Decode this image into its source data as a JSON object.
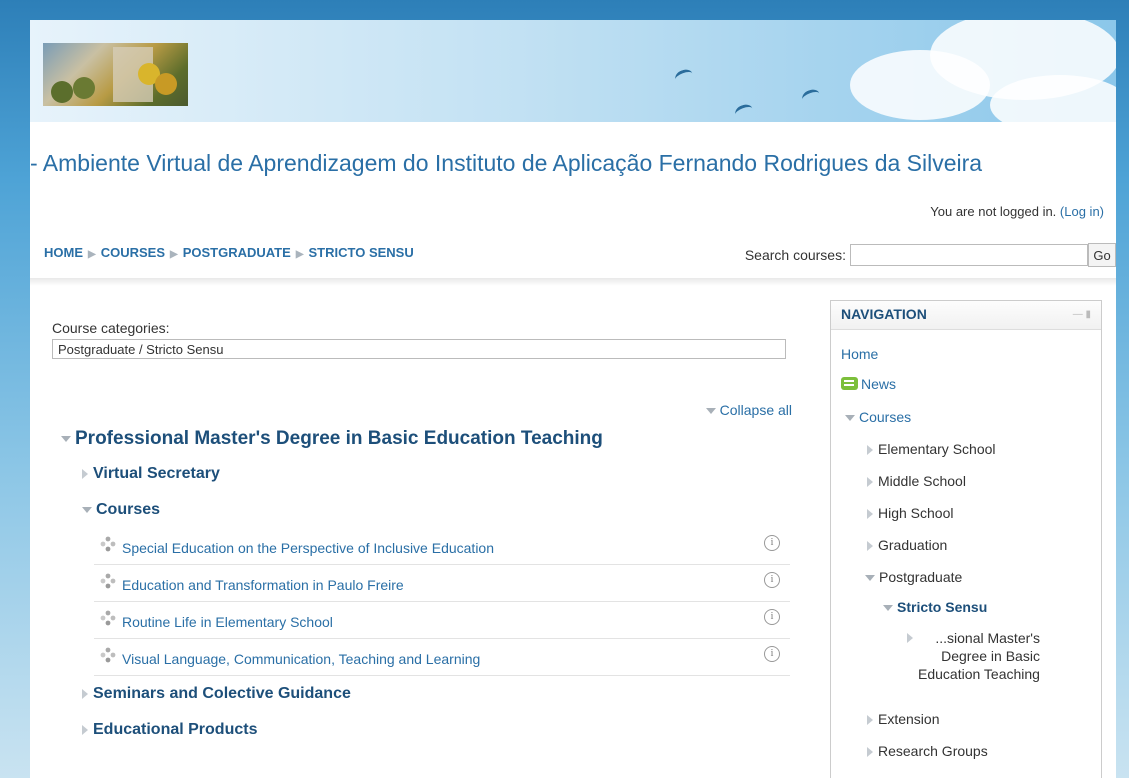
{
  "header": {
    "site_title": "- Ambiente Virtual de Aprendizagem do Instituto de Aplicação Fernando Rodrigues da Silveira",
    "login_text": "You are not logged in.",
    "login_link": "(Log in)"
  },
  "breadcrumb": [
    "HOME",
    "COURSES",
    "POSTGRADUATE",
    "STRICTO SENSU"
  ],
  "search": {
    "label": "Search courses:",
    "value": "",
    "go_label": "Go"
  },
  "main": {
    "categories_label": "Course categories:",
    "categories_selected": "Postgraduate / Stricto Sensu",
    "collapse_all": "Collapse all",
    "category_title": "Professional Master's Degree in Basic Education Teaching",
    "subcategories": [
      {
        "label": "Virtual Secretary",
        "expanded": false
      },
      {
        "label": "Courses",
        "expanded": true
      },
      {
        "label": "Seminars and Colective Guidance",
        "expanded": false
      },
      {
        "label": "Educational Products",
        "expanded": false
      }
    ],
    "courses": [
      "Special Education on the Perspective of Inclusive Education",
      "Education and Transformation in Paulo Freire",
      "Routine Life in Elementary School",
      "Visual Language, Communication, Teaching and Learning"
    ]
  },
  "navigation": {
    "title": "NAVIGATION",
    "home": "Home",
    "news": "News",
    "courses": "Courses",
    "items": [
      "Elementary School",
      "Middle School",
      "High School",
      "Graduation",
      "Postgraduate"
    ],
    "stricto": "Stricto Sensu",
    "program_lines": [
      "...sional Master's",
      "Degree in Basic",
      "Education Teaching"
    ],
    "after": [
      "Extension",
      "Research Groups"
    ]
  },
  "colors": {
    "link": "#2a6fa6",
    "heading": "#1d4f7a",
    "frame": "#3f95c9"
  }
}
